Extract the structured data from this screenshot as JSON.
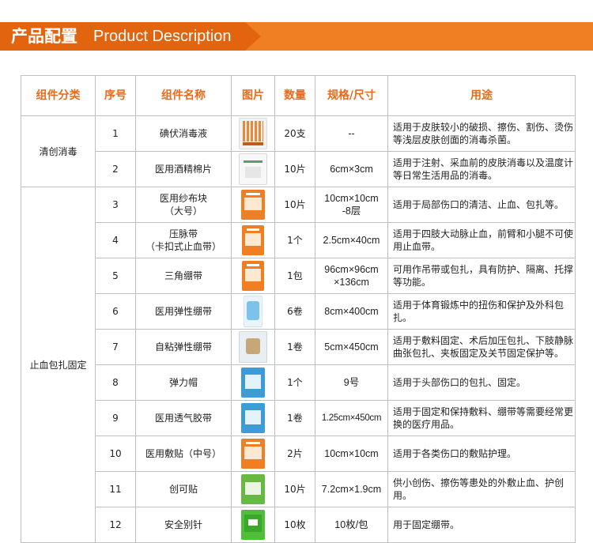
{
  "banner": {
    "title_cn": "产品配置",
    "title_en": "Product Description"
  },
  "colors": {
    "accent": "#f07e22",
    "accent_dark": "#e2640f",
    "header_text": "#ea6a1a"
  },
  "table": {
    "headers": [
      "组件分类",
      "序号",
      "组件名称",
      "图片",
      "数量",
      "规格/尺寸",
      "用途"
    ],
    "groups": [
      "清创消毒",
      "止血包扎固定"
    ],
    "rows": [
      {
        "no": "1",
        "name": "碘伏消毒液",
        "icon": "iodine-swab-pack-icon",
        "qty": "20支",
        "spec": "--",
        "use": "适用于皮肤较小的破损、擦伤、割伤、烫伤等浅层皮肤创面的消毒杀菌。"
      },
      {
        "no": "2",
        "name": "医用酒精棉片",
        "icon": "alcohol-pad-pack-icon",
        "qty": "10片",
        "spec": "6cm×3cm",
        "use": "适用于注射、采血前的皮肤消毒以及温度计等日常生活用品的消毒。"
      },
      {
        "no": "3",
        "name": "医用纱布块\n（大号）",
        "icon": "gauze-pad-pack-icon",
        "qty": "10片",
        "spec": "10cm×10cm\n-8层",
        "use": "适用于局部伤口的清洁、止血、包扎等。"
      },
      {
        "no": "4",
        "name": "压脉带\n（卡扣式止血带）",
        "icon": "tourniquet-pack-icon",
        "qty": "1个",
        "spec": "2.5cm×40cm",
        "use": "适用于四肢大动脉止血，前臂和小腿不可使用止血带。"
      },
      {
        "no": "5",
        "name": "三角绷带",
        "icon": "triangle-bandage-pack-icon",
        "qty": "1包",
        "spec": "96cm×96cm\n×136cm",
        "use": "可用作吊带或包扎，具有防护、隔离、托撑等功能。"
      },
      {
        "no": "6",
        "name": "医用弹性绷带",
        "icon": "elastic-bandage-roll-icon",
        "qty": "6卷",
        "spec": "8cm×400cm",
        "use": "适用于体育锻炼中的扭伤和保护及外科包扎。"
      },
      {
        "no": "7",
        "name": "自粘弹性绷带",
        "icon": "self-adhesive-bandage-icon",
        "qty": "1卷",
        "spec": "5cm×450cm",
        "use": "适用于敷料固定、术后加压包扎、下肢静脉曲张包扎、夹板固定及关节固定保护等。"
      },
      {
        "no": "8",
        "name": "弹力帽",
        "icon": "elastic-net-cap-pack-icon",
        "qty": "1个",
        "spec": "9号",
        "use": "适用于头部伤口的包扎、固定。"
      },
      {
        "no": "9",
        "name": "医用透气胶带",
        "icon": "breathable-tape-pack-icon",
        "qty": "1卷",
        "spec": "1.25cm×450cm",
        "use": "适用于固定和保持敷料、绷带等需要经常更换的医疗用品。"
      },
      {
        "no": "10",
        "name": "医用敷贴（中号）",
        "icon": "wound-dressing-pack-icon",
        "qty": "2片",
        "spec": "10cm×10cm",
        "use": "适用于各类伤口的敷贴护理。"
      },
      {
        "no": "11",
        "name": "创可贴",
        "icon": "band-aid-pack-icon",
        "qty": "10片",
        "spec": "7.2cm×1.9cm",
        "use": "供小创伤、擦伤等患处的外敷止血、护创用。"
      },
      {
        "no": "12",
        "name": "安全别针",
        "icon": "safety-pin-pack-icon",
        "qty": "10枚",
        "spec": "10枚/包",
        "use": "用于固定绷带。"
      }
    ]
  }
}
